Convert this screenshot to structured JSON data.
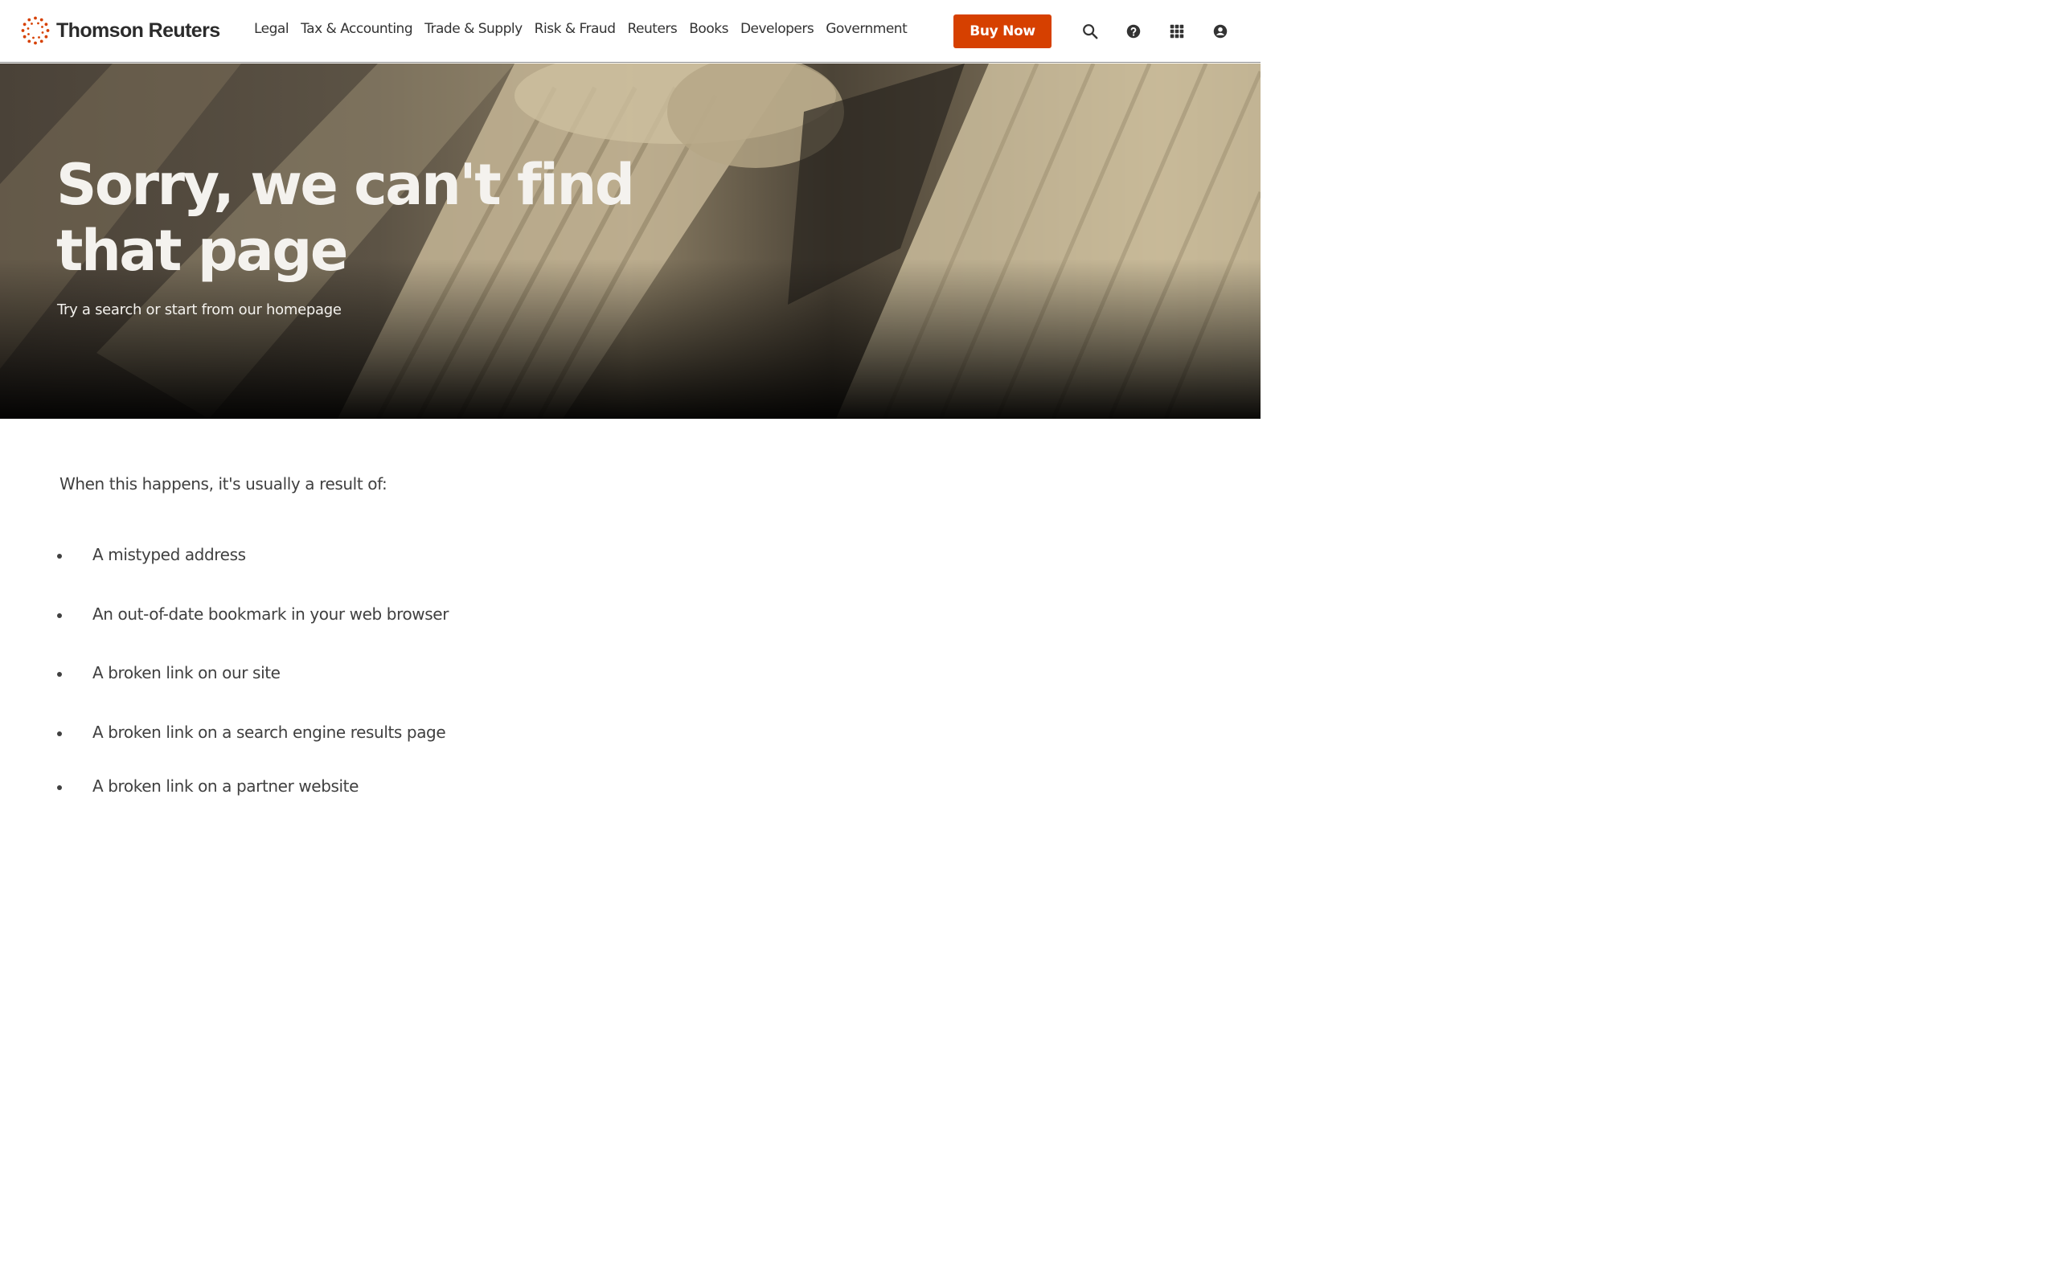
{
  "brand": {
    "name": "Thomson Reuters",
    "accent": "#d64000"
  },
  "nav": {
    "items": [
      {
        "label": "Legal"
      },
      {
        "label": "Tax & Accounting"
      },
      {
        "label": "Trade & Supply"
      },
      {
        "label": "Risk & Fraud"
      },
      {
        "label": "Reuters"
      },
      {
        "label": "Books"
      },
      {
        "label": "Developers"
      },
      {
        "label": "Government"
      }
    ],
    "buy_label": "Buy Now"
  },
  "header_icons": [
    "search-icon",
    "help-icon",
    "apps-grid-icon",
    "account-icon"
  ],
  "hero": {
    "title_line1": "Sorry, we can't find",
    "title_line2": "that page",
    "subtitle": "Try a search or start from our homepage"
  },
  "content": {
    "intro": "When this happens, it's usually a result of:",
    "reasons": [
      "A mistyped address",
      "An out-of-date bookmark in your web browser",
      "A broken link on our site",
      "A broken link on a search engine results page",
      "A broken link on a partner website"
    ]
  }
}
